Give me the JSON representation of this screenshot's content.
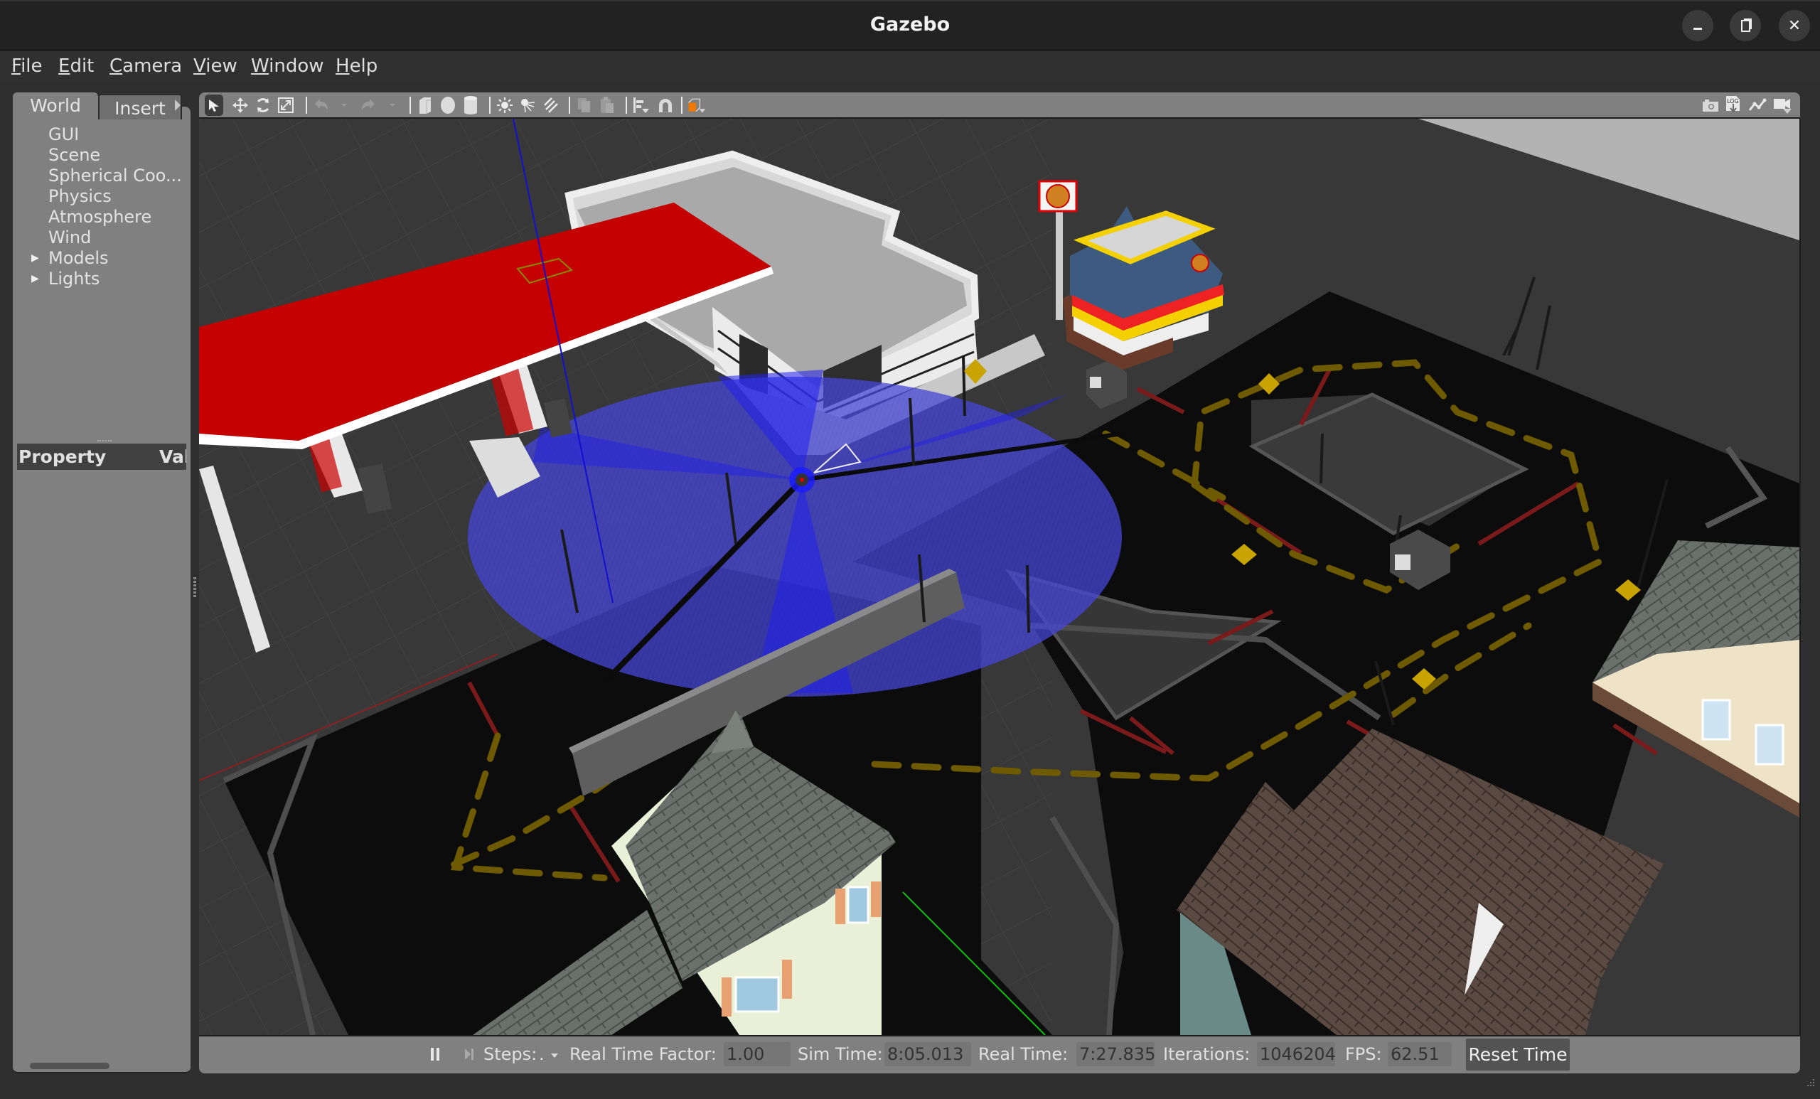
{
  "window": {
    "title": "Gazebo",
    "controls": {
      "minimize": "–",
      "maximize": "❐",
      "close": "✕"
    }
  },
  "menu": {
    "items": [
      {
        "label": "File",
        "mnemonic": "F",
        "rest": "ile"
      },
      {
        "label": "Edit",
        "mnemonic": "E",
        "rest": "dit"
      },
      {
        "label": "Camera",
        "mnemonic": "C",
        "rest": "amera"
      },
      {
        "label": "View",
        "mnemonic": "V",
        "rest": "iew"
      },
      {
        "label": "Window",
        "mnemonic": "W",
        "rest": "indow"
      },
      {
        "label": "Help",
        "mnemonic": "H",
        "rest": "elp"
      }
    ]
  },
  "left_panel": {
    "tabs": [
      {
        "label": "World",
        "active": true
      },
      {
        "label": "Insert",
        "active": false
      }
    ],
    "tree": [
      {
        "label": "GUI",
        "expandable": false
      },
      {
        "label": "Scene",
        "expandable": false
      },
      {
        "label": "Spherical Coo...",
        "expandable": false
      },
      {
        "label": "Physics",
        "expandable": false
      },
      {
        "label": "Atmosphere",
        "expandable": false
      },
      {
        "label": "Wind",
        "expandable": false
      },
      {
        "label": "Models",
        "expandable": true
      },
      {
        "label": "Lights",
        "expandable": true
      }
    ],
    "property_table": {
      "col_property": "Property",
      "col_value": "Val"
    }
  },
  "toolbar": {
    "left_tools": [
      {
        "name": "select-mode",
        "active": true
      },
      {
        "name": "translate-mode"
      },
      {
        "name": "rotate-mode"
      },
      {
        "name": "scale-mode"
      },
      {
        "name": "undo",
        "disabled": true
      },
      {
        "name": "redo",
        "disabled": true
      },
      {
        "name": "box-shape"
      },
      {
        "name": "sphere-shape"
      },
      {
        "name": "cylinder-shape"
      },
      {
        "name": "point-light"
      },
      {
        "name": "spot-light"
      },
      {
        "name": "directional-light"
      },
      {
        "name": "copy",
        "disabled": true
      },
      {
        "name": "paste",
        "disabled": true
      },
      {
        "name": "align"
      },
      {
        "name": "snap"
      },
      {
        "name": "view-angle"
      }
    ],
    "right_tools": [
      {
        "name": "screenshot"
      },
      {
        "name": "log",
        "label": "LOG"
      },
      {
        "name": "plot"
      },
      {
        "name": "video-record"
      }
    ]
  },
  "status_bar": {
    "steps_label": "Steps:",
    "steps_value": ".",
    "rtf_label": "Real Time Factor:",
    "rtf_value": "1.00",
    "sim_time_label": "Sim Time:",
    "sim_time_value": "8:05.013",
    "real_time_label": "Real Time:",
    "real_time_value": "7:27.835",
    "iterations_label": "Iterations:",
    "iterations_value": "1046204",
    "fps_label": "FPS:",
    "fps_value": "62.51",
    "reset_label": "Reset Time"
  },
  "scene": {
    "description": "3D city world: gas station with red canopy, white convenience store, fast-food restaurant, road blocks with yellow dashed lines, houses, robot with blue lidar scan",
    "colors": {
      "background": "#3a3a3a",
      "road": "#0b0b0b",
      "lane_dash": "#6b5800",
      "stop_line": "#7a1a1a",
      "lidar": "#1e1ee6",
      "canopy": "#c00000"
    }
  }
}
